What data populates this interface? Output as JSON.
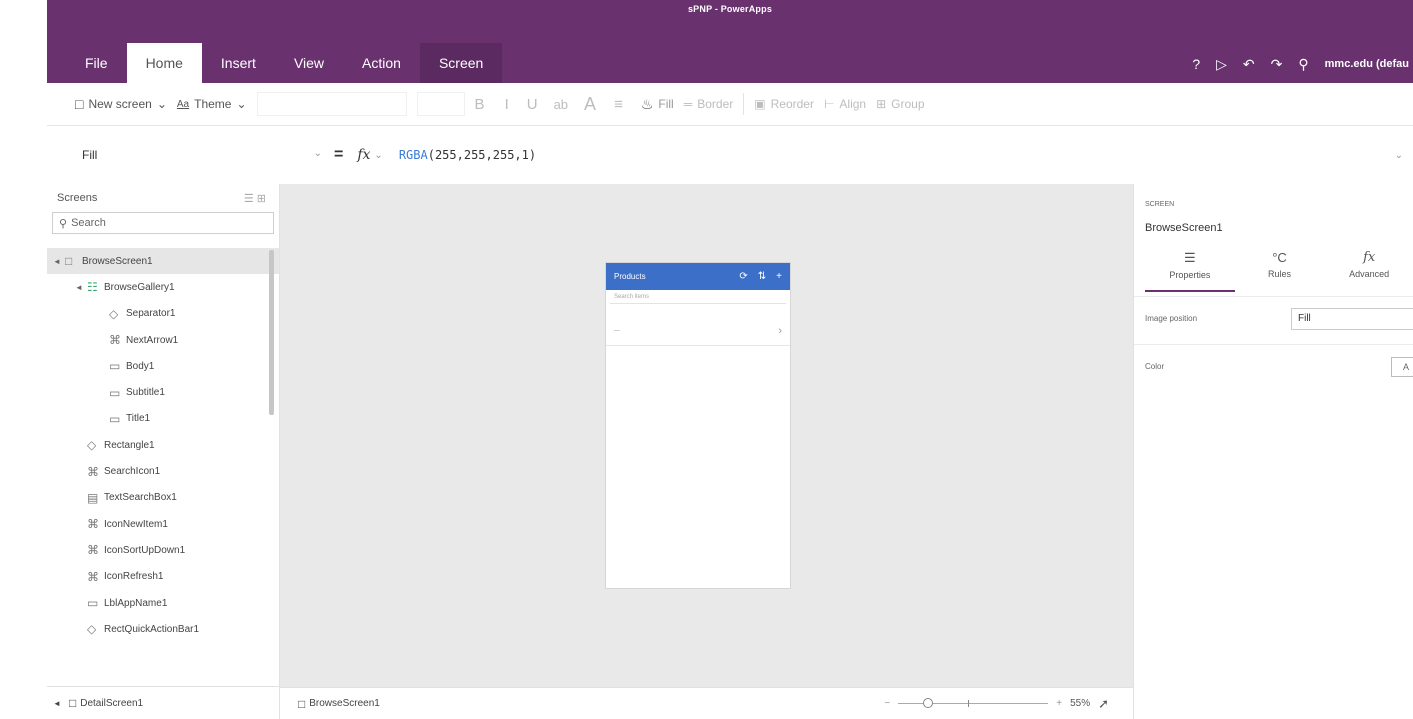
{
  "window": {
    "title": "sPNP - PowerApps"
  },
  "ribbon_tabs": [
    "File",
    "Home",
    "Insert",
    "View",
    "Action",
    "Screen"
  ],
  "top_right": {
    "help": "?",
    "play": "▷",
    "undo": "↶",
    "redo": "↷",
    "user": "mmc.edu (defau"
  },
  "toolbar": {
    "new_screen": "New screen",
    "theme": "Theme",
    "bold": "B",
    "italic": "I",
    "underline": "U",
    "strike": "ab",
    "font_size": "A",
    "align_text": "≡",
    "fill": "Fill",
    "border": "Border",
    "reorder": "Reorder",
    "align": "Align",
    "group": "Group"
  },
  "formula_bar": {
    "property": "Fill",
    "fx": "fx",
    "fn_name": "RGBA",
    "fn_args": "(255,255,255,1)"
  },
  "tree": {
    "header": "Screens",
    "search_placeholder": "Search",
    "items": [
      {
        "label": "BrowseScreen1",
        "level": 0,
        "caret": "◄",
        "icon": "screen-icon",
        "selected": true
      },
      {
        "label": "BrowseGallery1",
        "level": 1,
        "caret": "◄",
        "icon": "gallery-icon"
      },
      {
        "label": "Separator1",
        "level": 2,
        "icon": "shape-icon"
      },
      {
        "label": "NextArrow1",
        "level": 2,
        "icon": "icon-icon"
      },
      {
        "label": "Body1",
        "level": 2,
        "icon": "label-icon"
      },
      {
        "label": "Subtitle1",
        "level": 2,
        "icon": "label-icon"
      },
      {
        "label": "Title1",
        "level": 2,
        "icon": "label-icon"
      },
      {
        "label": "Rectangle1",
        "level": 1,
        "icon": "shape-icon"
      },
      {
        "label": "SearchIcon1",
        "level": 1,
        "icon": "icon-icon"
      },
      {
        "label": "TextSearchBox1",
        "level": 1,
        "icon": "textbox-icon"
      },
      {
        "label": "IconNewItem1",
        "level": 1,
        "icon": "icon-icon"
      },
      {
        "label": "IconSortUpDown1",
        "level": 1,
        "icon": "icon-icon"
      },
      {
        "label": "IconRefresh1",
        "level": 1,
        "icon": "icon-icon"
      },
      {
        "label": "LblAppName1",
        "level": 1,
        "icon": "label-icon"
      },
      {
        "label": "RectQuickActionBar1",
        "level": 1,
        "icon": "shape-icon"
      }
    ],
    "footer": "DetailScreen1"
  },
  "phone": {
    "title": "Products",
    "search_placeholder": "Search items",
    "row_text": "—"
  },
  "status_bar": {
    "screen": "BrowseScreen1",
    "zoom": "55%",
    "zoom_fraction": 0.2
  },
  "properties": {
    "type": "SCREEN",
    "name": "BrowseScreen1",
    "tabs": [
      {
        "label": "Properties",
        "icon": "☰"
      },
      {
        "label": "Rules",
        "icon": "°C"
      },
      {
        "label": "Advanced",
        "icon": "fx"
      }
    ],
    "rows": [
      {
        "label": "Image position",
        "value": "Fill"
      },
      {
        "label": "Color",
        "value": "A"
      }
    ]
  },
  "colors": {
    "brand": "#69326f",
    "canvas": "#e9e9e9",
    "app_header": "#3c6fc8",
    "gallery_icon": "#3aa56e"
  }
}
